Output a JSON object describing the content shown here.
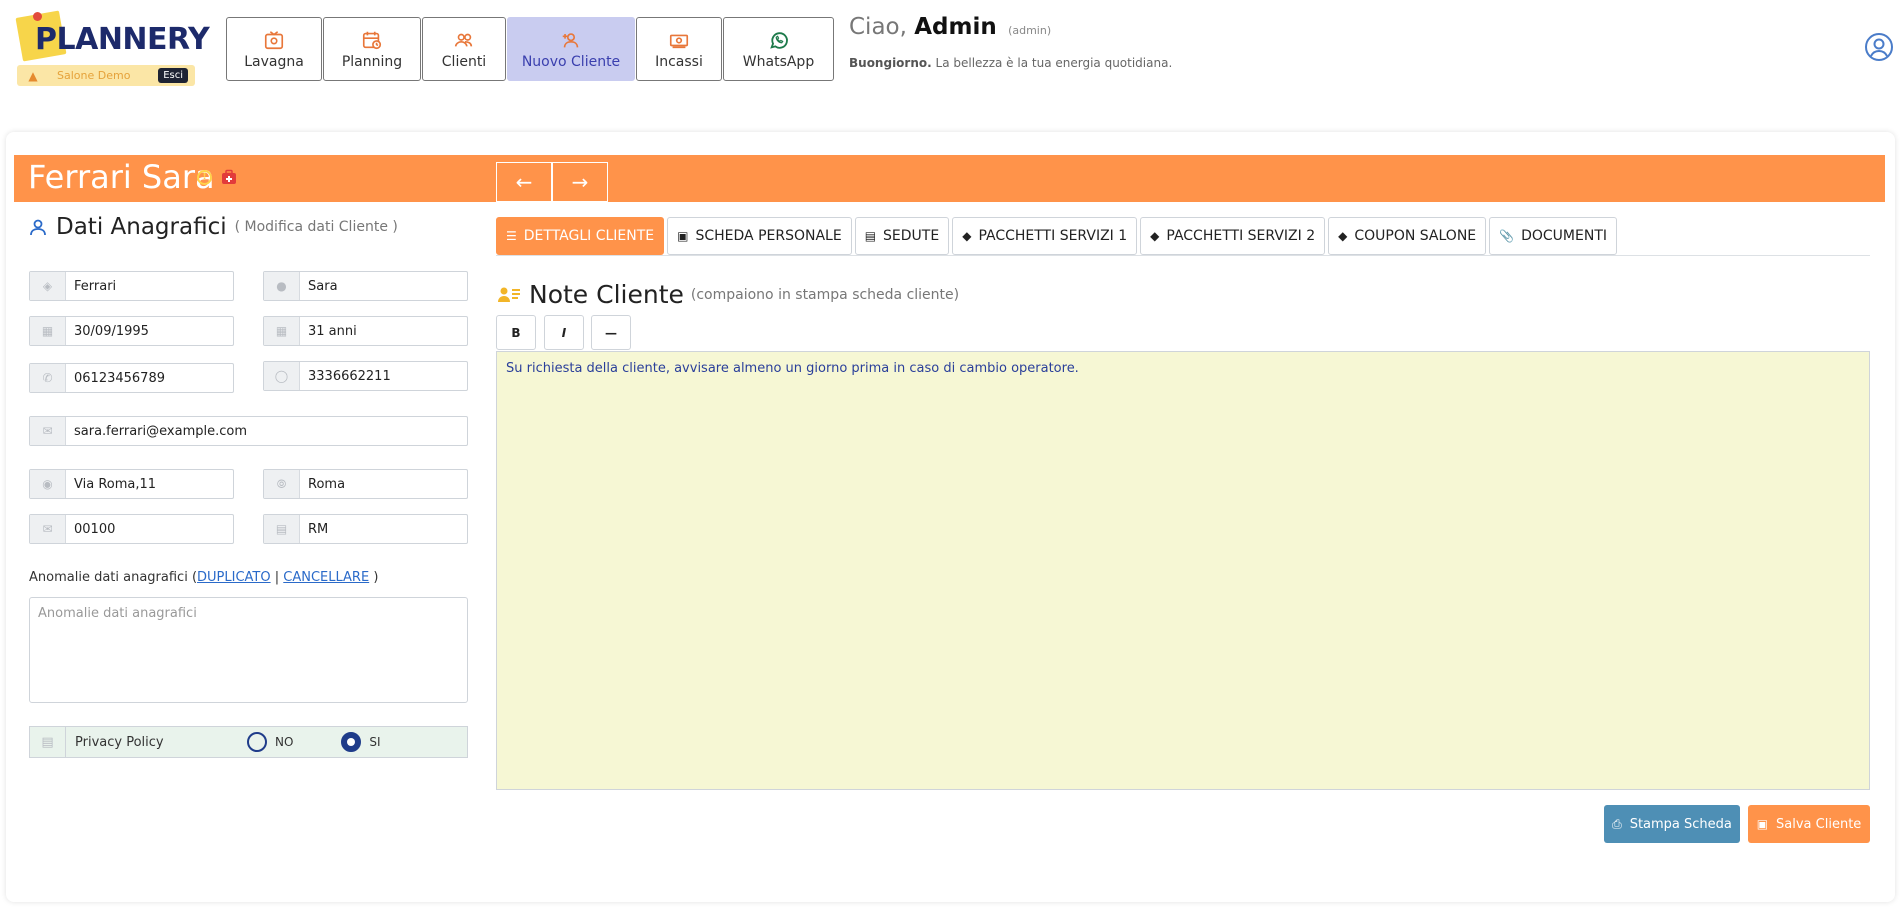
{
  "brand": {
    "name": "PLANNERY",
    "salon": "Salone Demo",
    "exit_label": "Esci"
  },
  "nav": [
    {
      "label": "Lavagna",
      "icon": "board-icon"
    },
    {
      "label": "Planning",
      "icon": "calendar-clock-icon"
    },
    {
      "label": "Clienti",
      "icon": "users-icon"
    },
    {
      "label": "Nuovo Cliente",
      "icon": "user-plus-icon",
      "active": true
    },
    {
      "label": "Incassi",
      "icon": "cash-icon"
    },
    {
      "label": "WhatsApp",
      "icon": "whatsapp-icon"
    }
  ],
  "greeting": {
    "hello": "Ciao,",
    "user": "Admin",
    "role": "(admin)",
    "salutation": "Buongiorno.",
    "tagline": "La bellezza è la tua energia quotidiana."
  },
  "client": {
    "full_name": "Ferrari Sara"
  },
  "left": {
    "title": "Dati Anagrafici",
    "subtitle": "( Modifica dati Cliente )",
    "fields": {
      "surname": "Ferrari",
      "name": "Sara",
      "birthdate": "30/09/1995",
      "age": "31 anni",
      "phone": "06123456789",
      "mobile": "3336662211",
      "email": "sara.ferrari@example.com",
      "address": "Via Roma,11",
      "city": "Roma",
      "zip": "00100",
      "province": "RM"
    },
    "anomalies": {
      "label_pre": "Anomalie dati anagrafici (",
      "duplicate": "DUPLICATO",
      "sep": " | ",
      "delete": "CANCELLARE",
      "label_post": " )",
      "placeholder": "Anomalie dati anagrafici"
    },
    "privacy": {
      "label": "Privacy Policy",
      "no": "NO",
      "yes": "SI",
      "selected": "SI"
    }
  },
  "tabs": [
    {
      "label": "DETTAGLI CLIENTE",
      "active": true
    },
    {
      "label": "SCHEDA PERSONALE"
    },
    {
      "label": "SEDUTE"
    },
    {
      "label": "PACCHETTI SERVIZI 1"
    },
    {
      "label": "PACCHETTI SERVIZI 2"
    },
    {
      "label": "COUPON SALONE"
    },
    {
      "label": "DOCUMENTI"
    }
  ],
  "notes": {
    "title": "Note Cliente",
    "subtitle": "(compaiono in stampa scheda cliente)",
    "bold": "B",
    "italic": "I",
    "hr": "—",
    "text": "Su richiesta della cliente, avvisare almeno un giorno prima in caso di cambio operatore."
  },
  "actions": {
    "print": "Stampa Scheda",
    "save": "Salva Cliente"
  },
  "colors": {
    "accent": "#ff934a",
    "navy": "#1d2a6b",
    "notes_bg": "#f6f7d4",
    "print_btn": "#4e8fb5"
  }
}
